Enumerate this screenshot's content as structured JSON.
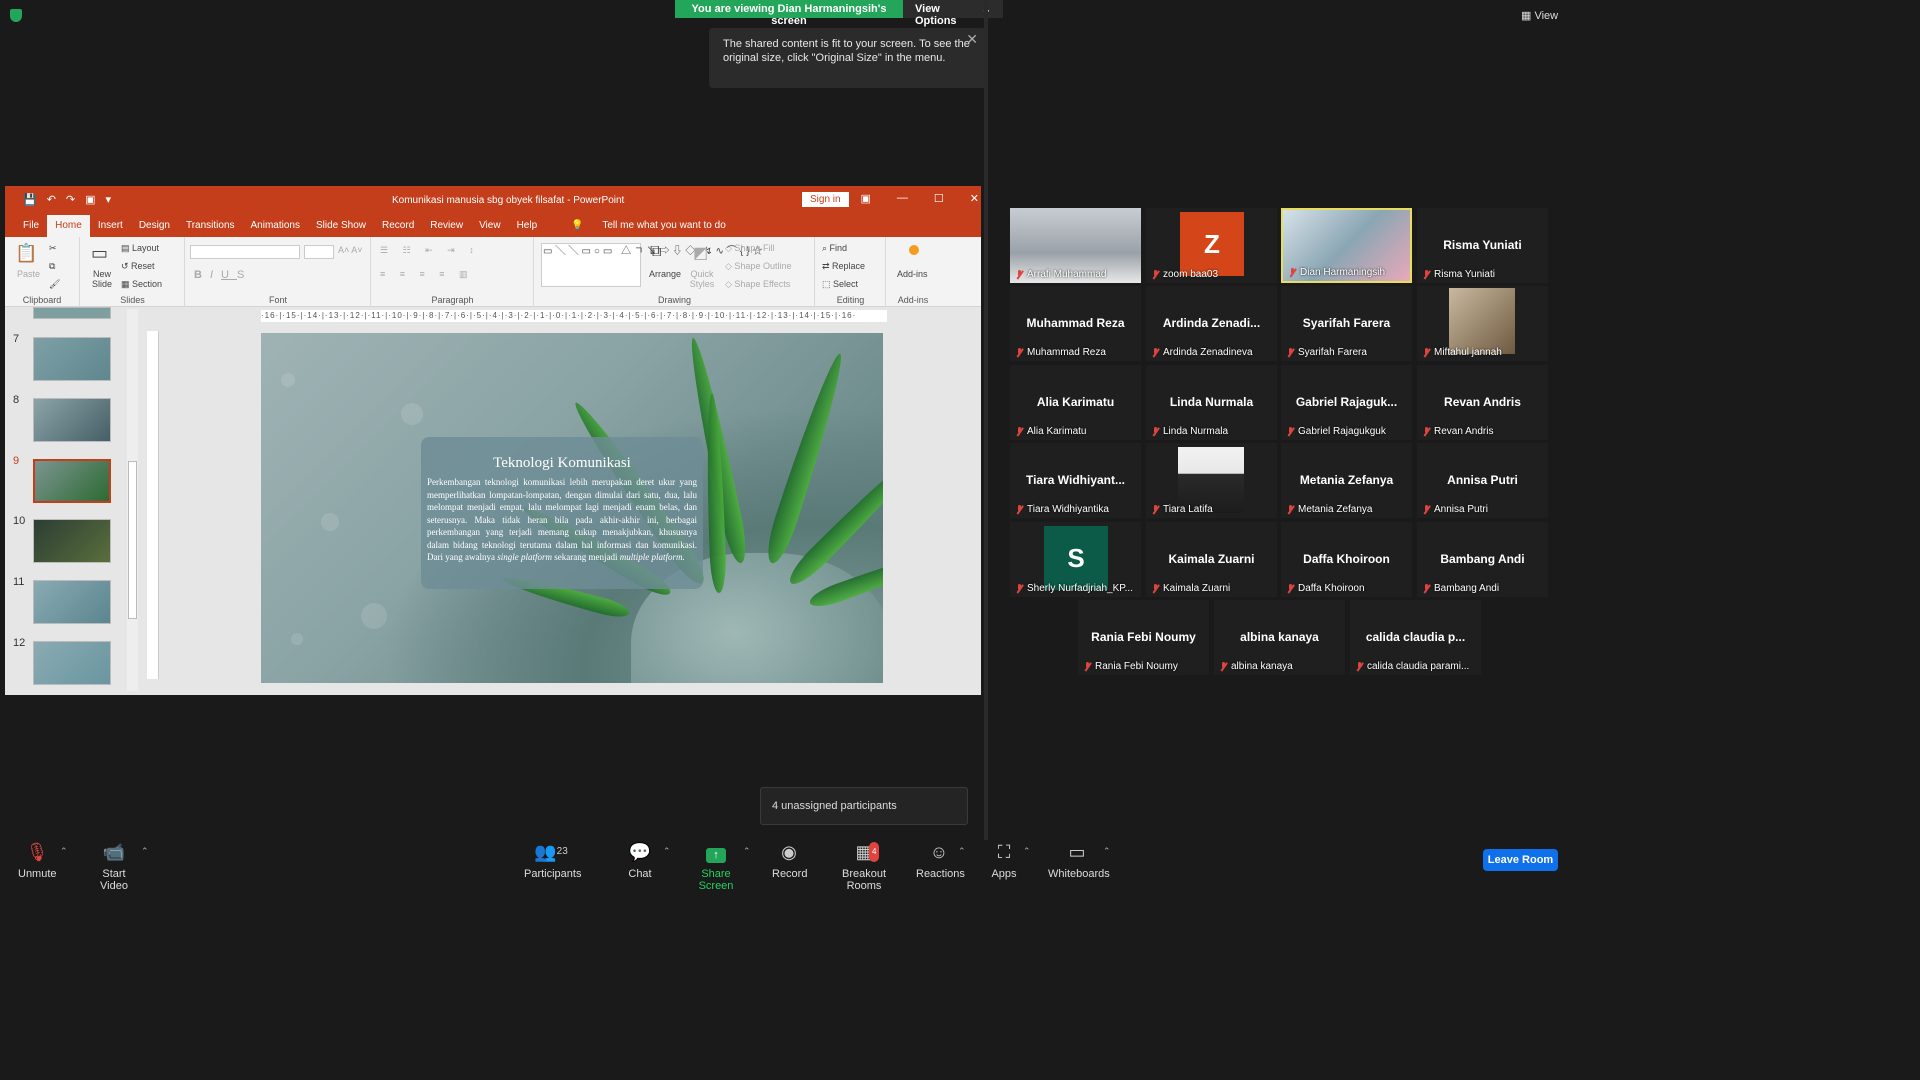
{
  "banner": {
    "viewing": "You are viewing Dian Harmaningsih's screen",
    "view_options": "View Options"
  },
  "top_right_view": "View",
  "tooltip": "The shared content is fit to your screen. To see the original size, click \"Original Size\" in the menu.",
  "ppt": {
    "title": "Komunikasi manusia sbg obyek filsafat  -  PowerPoint",
    "sign_in": "Sign in",
    "tabs": [
      "File",
      "Home",
      "Insert",
      "Design",
      "Transitions",
      "Animations",
      "Slide Show",
      "Record",
      "Review",
      "View",
      "Help"
    ],
    "tell_me": "Tell me what you want to do",
    "ribbon": {
      "clipboard": "Clipboard",
      "paste": "Paste",
      "slides": "Slides",
      "new_slide": "New Slide",
      "layout": "Layout",
      "reset": "Reset",
      "section": "Section",
      "font": "Font",
      "paragraph": "Paragraph",
      "drawing": "Drawing",
      "arrange": "Arrange",
      "quick_styles": "Quick Styles",
      "shape_fill": "Shape Fill",
      "shape_outline": "Shape Outline",
      "shape_effects": "Shape Effects",
      "editing": "Editing",
      "find": "Find",
      "replace": "Replace",
      "select": "Select",
      "addins": "Add-ins",
      "addins_btn": "Add-ins"
    },
    "ruler": "·16·|·15·|·14·|·13·|·12·|·11·|·10·|·9·|·8·|·7·|·6·|·5·|·4·|·3·|·2·|·1·|·0·|·1·|·2·|·3·|·4·|·5·|·6·|·7·|·8·|·9·|·10·|·11·|·12·|·13·|·14·|·15·|·16·",
    "thumb_numbers": [
      "7",
      "8",
      "9",
      "10",
      "11",
      "12"
    ],
    "slide": {
      "heading": "Teknologi Komunikasi",
      "body": "Perkembangan teknologi komunikasi lebih merupakan deret ukur yang memperlihatkan lompatan-lompatan, dengan dimulai dari satu, dua, lalu melompat menjadi empat, lalu melompat lagi menjadi enam belas, dan seterusnya. Maka tidak heran bila pada akhir-akhir ini, berbagai perkembangan yang terjadi memang cukup menakjubkan, khususnya dalam bidang teknologi terutama dalam hal informasi dan komunikasi. Dari yang awalnya ",
      "body_italic1": "single platform",
      "body_mid": " sekarang menjadi ",
      "body_italic2": "multiple platform."
    }
  },
  "participants": [
    {
      "tile": "",
      "label": "Arrafi Muhammad",
      "video": true
    },
    {
      "tile": "Z",
      "label": "zoom baa03",
      "letter": true,
      "color": "#d4461a"
    },
    {
      "tile": "",
      "label": "Dian Harmaningsih",
      "video": true,
      "speaking": true
    },
    {
      "tile": "Risma Yuniati",
      "label": "Risma Yuniati"
    },
    {
      "tile": "Muhammad Reza",
      "label": "Muhammad Reza"
    },
    {
      "tile": "Ardinda  Zenadi...",
      "label": "Ardinda Zenadineva"
    },
    {
      "tile": "Syarifah Farera",
      "label": "Syarifah Farera"
    },
    {
      "tile": "",
      "label": "Miftahul jannah",
      "video": true
    },
    {
      "tile": "Alia Karimatu",
      "label": "Alia Karimatu"
    },
    {
      "tile": "Linda Nurmala",
      "label": "Linda Nurmala"
    },
    {
      "tile": "Gabriel  Rajaguk...",
      "label": "Gabriel Rajagukguk"
    },
    {
      "tile": "Revan Andris",
      "label": "Revan Andris"
    },
    {
      "tile": "Tiara  Widhiyant...",
      "label": "Tiara Widhiyantika"
    },
    {
      "tile": "",
      "label": "Tiara Latifa",
      "video": true
    },
    {
      "tile": "Metania Zefanya",
      "label": "Metania Zefanya"
    },
    {
      "tile": "Annisa Putri",
      "label": "Annisa Putri"
    },
    {
      "tile": "S",
      "label": "Sherly Nurfadjriah_KP...",
      "letter": true,
      "color": "#0c5a48"
    },
    {
      "tile": "Kaimala Zuarni",
      "label": "Kaimala Zuarni"
    },
    {
      "tile": "Daffa Khoiroon",
      "label": "Daffa Khoiroon"
    },
    {
      "tile": "Bambang Andi",
      "label": "Bambang Andi"
    },
    {
      "tile": "Rania Febi Noumy",
      "label": "Rania Febi Noumy"
    },
    {
      "tile": "albina kanaya",
      "label": "albina kanaya"
    },
    {
      "tile": "calida  claudia  p...",
      "label": "calida claudia parami..."
    }
  ],
  "unassigned": "4 unassigned participants",
  "toolbar": {
    "unmute": "Unmute",
    "start_video": "Start Video",
    "participants": "Participants",
    "participants_count": "23",
    "chat": "Chat",
    "share_screen": "Share Screen",
    "record": "Record",
    "breakout_rooms": "Breakout Rooms",
    "breakout_badge": "4",
    "reactions": "Reactions",
    "apps": "Apps",
    "whiteboards": "Whiteboards",
    "leave": "Leave Room"
  }
}
